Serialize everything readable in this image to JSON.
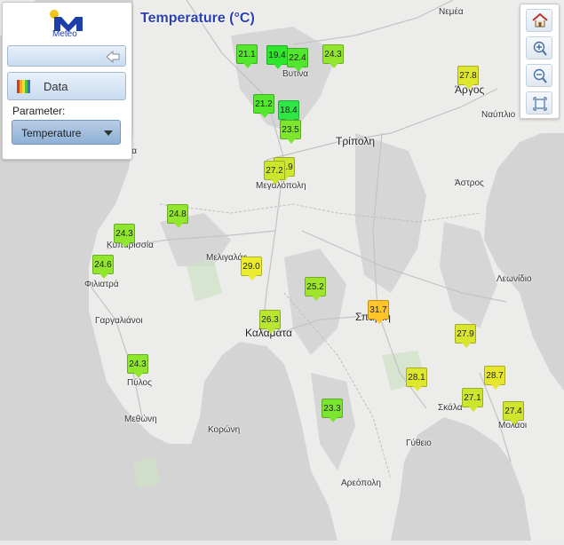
{
  "title": "Temperature (°C)",
  "panel": {
    "logo_text": "Meteo",
    "data_label": "Data",
    "parameter_label": "Parameter:",
    "parameter_value": "Temperature"
  },
  "toolbar": {
    "icons": [
      "home-icon",
      "zoom-in-icon",
      "zoom-out-icon",
      "fullscreen-icon"
    ]
  },
  "places": [
    {
      "name": "Νεμέα",
      "big": false
    },
    {
      "name": "Βυτίνα",
      "big": false
    },
    {
      "name": "Άργος",
      "big": true
    },
    {
      "name": "Ναύπλιο",
      "big": false
    },
    {
      "name": "Τρίπολη",
      "big": true
    },
    {
      "name": "Μεγαλόπολη",
      "big": false
    },
    {
      "name": "Άστρος",
      "big": false
    },
    {
      "name": "Κυπαρισσία",
      "big": false
    },
    {
      "name": "Φιλιατρά",
      "big": false
    },
    {
      "name": "Μελιγαλάς",
      "big": false
    },
    {
      "name": "Λεωνίδιο",
      "big": false
    },
    {
      "name": "Γαργαλιάνοι",
      "big": false
    },
    {
      "name": "Σπάρτη",
      "big": true
    },
    {
      "name": "Καλαμάτα",
      "big": true
    },
    {
      "name": "Πύλος",
      "big": false
    },
    {
      "name": "Σκάλα",
      "big": false
    },
    {
      "name": "Μολάοι",
      "big": false
    },
    {
      "name": "Μεθώνη",
      "big": false
    },
    {
      "name": "Κορώνη",
      "big": false
    },
    {
      "name": "Γύθειο",
      "big": false
    },
    {
      "name": "Αρεόπολη",
      "big": false
    },
    {
      "name": "ια",
      "big": false
    }
  ],
  "stations": [
    {
      "value": "21.1",
      "color": "#55e62e"
    },
    {
      "value": "19.4",
      "color": "#2ee62e"
    },
    {
      "value": "22.4",
      "color": "#52e62e"
    },
    {
      "value": "24.3",
      "color": "#93e62e"
    },
    {
      "value": "27.8",
      "color": "#dfe62e"
    },
    {
      "value": "21.2",
      "color": "#55e62e"
    },
    {
      "value": "18.4",
      "color": "#2ee646"
    },
    {
      "value": "23.5",
      "color": "#7ee62e"
    },
    {
      "value": "27.9",
      "color": "#cfe62e"
    },
    {
      "value": "27.2",
      "color": "#cce62e"
    },
    {
      "value": "24.8",
      "color": "#93e62e"
    },
    {
      "value": "24.3",
      "color": "#8fe62e"
    },
    {
      "value": "24.6",
      "color": "#93e62e"
    },
    {
      "value": "29.0",
      "color": "#ecec2e"
    },
    {
      "value": "25.2",
      "color": "#9ee62e"
    },
    {
      "value": "31.7",
      "color": "#ffc42a"
    },
    {
      "value": "27.9",
      "color": "#d8e62e"
    },
    {
      "value": "26.3",
      "color": "#b9e62e"
    },
    {
      "value": "24.3",
      "color": "#8fe62e"
    },
    {
      "value": "28.1",
      "color": "#dfe62e"
    },
    {
      "value": "28.7",
      "color": "#e6e62e"
    },
    {
      "value": "27.1",
      "color": "#cce62e"
    },
    {
      "value": "27.4",
      "color": "#d0e62e"
    },
    {
      "value": "23.3",
      "color": "#7ae62e"
    }
  ]
}
